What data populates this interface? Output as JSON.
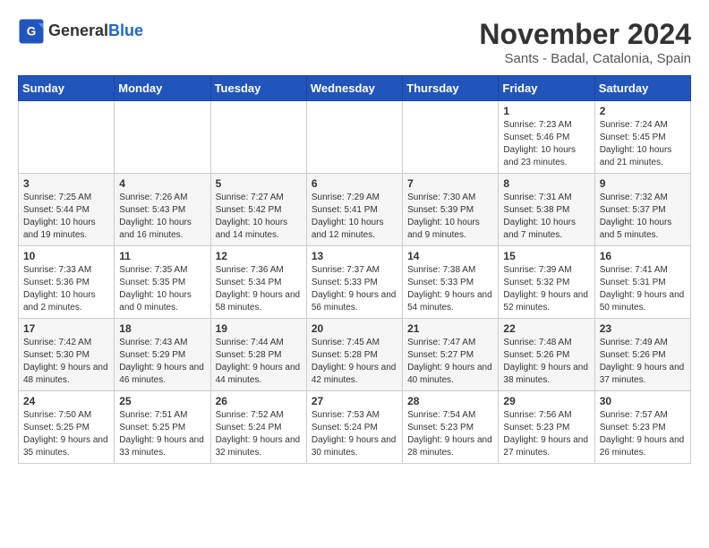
{
  "header": {
    "logo_line1": "General",
    "logo_line2": "Blue",
    "month_title": "November 2024",
    "subtitle": "Sants - Badal, Catalonia, Spain"
  },
  "weekdays": [
    "Sunday",
    "Monday",
    "Tuesday",
    "Wednesday",
    "Thursday",
    "Friday",
    "Saturday"
  ],
  "weeks": [
    [
      {
        "day": "",
        "info": ""
      },
      {
        "day": "",
        "info": ""
      },
      {
        "day": "",
        "info": ""
      },
      {
        "day": "",
        "info": ""
      },
      {
        "day": "",
        "info": ""
      },
      {
        "day": "1",
        "info": "Sunrise: 7:23 AM\nSunset: 5:46 PM\nDaylight: 10 hours and 23 minutes."
      },
      {
        "day": "2",
        "info": "Sunrise: 7:24 AM\nSunset: 5:45 PM\nDaylight: 10 hours and 21 minutes."
      }
    ],
    [
      {
        "day": "3",
        "info": "Sunrise: 7:25 AM\nSunset: 5:44 PM\nDaylight: 10 hours and 19 minutes."
      },
      {
        "day": "4",
        "info": "Sunrise: 7:26 AM\nSunset: 5:43 PM\nDaylight: 10 hours and 16 minutes."
      },
      {
        "day": "5",
        "info": "Sunrise: 7:27 AM\nSunset: 5:42 PM\nDaylight: 10 hours and 14 minutes."
      },
      {
        "day": "6",
        "info": "Sunrise: 7:29 AM\nSunset: 5:41 PM\nDaylight: 10 hours and 12 minutes."
      },
      {
        "day": "7",
        "info": "Sunrise: 7:30 AM\nSunset: 5:39 PM\nDaylight: 10 hours and 9 minutes."
      },
      {
        "day": "8",
        "info": "Sunrise: 7:31 AM\nSunset: 5:38 PM\nDaylight: 10 hours and 7 minutes."
      },
      {
        "day": "9",
        "info": "Sunrise: 7:32 AM\nSunset: 5:37 PM\nDaylight: 10 hours and 5 minutes."
      }
    ],
    [
      {
        "day": "10",
        "info": "Sunrise: 7:33 AM\nSunset: 5:36 PM\nDaylight: 10 hours and 2 minutes."
      },
      {
        "day": "11",
        "info": "Sunrise: 7:35 AM\nSunset: 5:35 PM\nDaylight: 10 hours and 0 minutes."
      },
      {
        "day": "12",
        "info": "Sunrise: 7:36 AM\nSunset: 5:34 PM\nDaylight: 9 hours and 58 minutes."
      },
      {
        "day": "13",
        "info": "Sunrise: 7:37 AM\nSunset: 5:33 PM\nDaylight: 9 hours and 56 minutes."
      },
      {
        "day": "14",
        "info": "Sunrise: 7:38 AM\nSunset: 5:33 PM\nDaylight: 9 hours and 54 minutes."
      },
      {
        "day": "15",
        "info": "Sunrise: 7:39 AM\nSunset: 5:32 PM\nDaylight: 9 hours and 52 minutes."
      },
      {
        "day": "16",
        "info": "Sunrise: 7:41 AM\nSunset: 5:31 PM\nDaylight: 9 hours and 50 minutes."
      }
    ],
    [
      {
        "day": "17",
        "info": "Sunrise: 7:42 AM\nSunset: 5:30 PM\nDaylight: 9 hours and 48 minutes."
      },
      {
        "day": "18",
        "info": "Sunrise: 7:43 AM\nSunset: 5:29 PM\nDaylight: 9 hours and 46 minutes."
      },
      {
        "day": "19",
        "info": "Sunrise: 7:44 AM\nSunset: 5:28 PM\nDaylight: 9 hours and 44 minutes."
      },
      {
        "day": "20",
        "info": "Sunrise: 7:45 AM\nSunset: 5:28 PM\nDaylight: 9 hours and 42 minutes."
      },
      {
        "day": "21",
        "info": "Sunrise: 7:47 AM\nSunset: 5:27 PM\nDaylight: 9 hours and 40 minutes."
      },
      {
        "day": "22",
        "info": "Sunrise: 7:48 AM\nSunset: 5:26 PM\nDaylight: 9 hours and 38 minutes."
      },
      {
        "day": "23",
        "info": "Sunrise: 7:49 AM\nSunset: 5:26 PM\nDaylight: 9 hours and 37 minutes."
      }
    ],
    [
      {
        "day": "24",
        "info": "Sunrise: 7:50 AM\nSunset: 5:25 PM\nDaylight: 9 hours and 35 minutes."
      },
      {
        "day": "25",
        "info": "Sunrise: 7:51 AM\nSunset: 5:25 PM\nDaylight: 9 hours and 33 minutes."
      },
      {
        "day": "26",
        "info": "Sunrise: 7:52 AM\nSunset: 5:24 PM\nDaylight: 9 hours and 32 minutes."
      },
      {
        "day": "27",
        "info": "Sunrise: 7:53 AM\nSunset: 5:24 PM\nDaylight: 9 hours and 30 minutes."
      },
      {
        "day": "28",
        "info": "Sunrise: 7:54 AM\nSunset: 5:23 PM\nDaylight: 9 hours and 28 minutes."
      },
      {
        "day": "29",
        "info": "Sunrise: 7:56 AM\nSunset: 5:23 PM\nDaylight: 9 hours and 27 minutes."
      },
      {
        "day": "30",
        "info": "Sunrise: 7:57 AM\nSunset: 5:23 PM\nDaylight: 9 hours and 26 minutes."
      }
    ]
  ]
}
